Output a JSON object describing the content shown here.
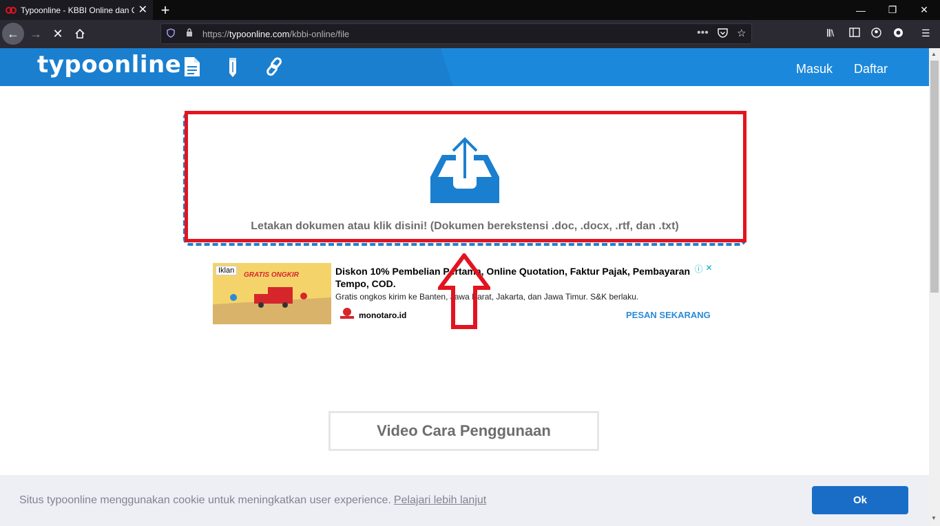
{
  "browser": {
    "tab_title": "Typoonline - KBBI Online dan C",
    "url_scheme": "https://",
    "url_host": "typoonline.com",
    "url_path": "/kbbi-online/file",
    "icons": [
      "back-icon",
      "forward-icon",
      "stop-icon",
      "home-icon",
      "shield-icon",
      "lock-icon",
      "more-icon",
      "pocket-icon",
      "star-icon",
      "library-icon",
      "sidebar-icon",
      "account-icon",
      "sync-icon",
      "menu-icon"
    ]
  },
  "site": {
    "logo": "typoonline",
    "nav": {
      "login": "Masuk",
      "register": "Daftar"
    },
    "colors": {
      "brand": "#1a7fcf",
      "highlight": "#e3131f"
    }
  },
  "upload": {
    "instruction": "Letakan dokumen atau klik disini! (Dokumen berekstensi .doc, .docx, .rtf, dan .txt)"
  },
  "ad": {
    "label": "Iklan",
    "image_caption": "GRATIS ONGKIR",
    "title": "Diskon 10% Pembelian Pertama, Online Quotation, Faktur Pajak, Pembayaran Tempo, COD.",
    "description": "Gratis ongkos kirim ke Banten, Jawa Barat, Jakarta, dan Jawa Timur. S&K berlaku.",
    "brand": "monotaro.id",
    "cta": "PESAN SEKARANG"
  },
  "video_button": "Video Cara Penggunaan",
  "cookie": {
    "message": "Situs typoonline menggunakan cookie untuk meningkatkan user experience.",
    "link": "Pelajari lebih lanjut",
    "ok": "Ok"
  }
}
